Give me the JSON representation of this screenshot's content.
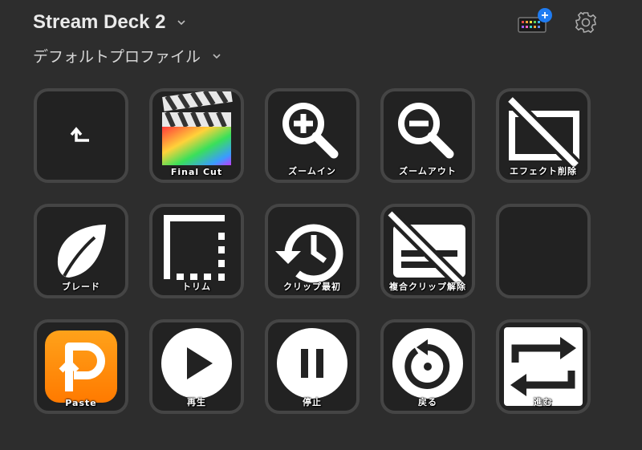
{
  "header": {
    "device_name": "Stream Deck 2",
    "profile_name": "デフォルトプロファイル"
  },
  "colors": {
    "background": "#2d2d2d",
    "key_bg": "#222222",
    "key_border": "#454545",
    "badge": "#1f7cf2"
  },
  "keys": [
    {
      "label": "",
      "icon": "return-arrow-icon"
    },
    {
      "label": "Final Cut",
      "icon": "final-cut-icon"
    },
    {
      "label": "ズームイン",
      "icon": "zoom-in-icon"
    },
    {
      "label": "ズームアウト",
      "icon": "zoom-out-icon"
    },
    {
      "label": "エフェクト削除",
      "icon": "remove-effect-icon"
    },
    {
      "label": "ブレード",
      "icon": "blade-leaf-icon"
    },
    {
      "label": "トリム",
      "icon": "trim-icon"
    },
    {
      "label": "クリップ最初",
      "icon": "clip-start-history-icon"
    },
    {
      "label": "複合クリップ解除",
      "icon": "compound-clip-release-icon"
    },
    {
      "label": "",
      "icon": "empty-key"
    },
    {
      "label": "Paste",
      "icon": "paste-app-icon"
    },
    {
      "label": "再生",
      "icon": "play-icon"
    },
    {
      "label": "停止",
      "icon": "pause-icon"
    },
    {
      "label": "戻る",
      "icon": "rewind-icon"
    },
    {
      "label": "進む",
      "icon": "repeat-forward-icon"
    }
  ]
}
